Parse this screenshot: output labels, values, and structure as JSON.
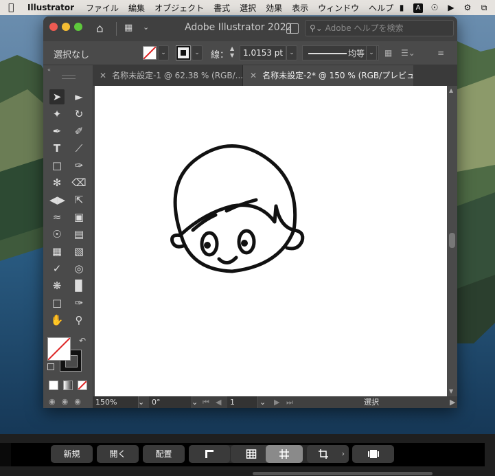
{
  "menubar": {
    "app": "Illustrator",
    "items": [
      "ファイル",
      "編集",
      "オブジェクト",
      "書式",
      "選択",
      "効果",
      "表示",
      "ウィンドウ",
      "ヘルプ"
    ],
    "status_icons": [
      "camera-icon",
      "input-source-icon",
      "accessibility-icon",
      "play-icon",
      "notification-icon",
      "window-icon"
    ],
    "input_source_label": "A"
  },
  "window": {
    "title": "Adobe Illustrator 2022",
    "search_placeholder": "Adobe ヘルプを検索"
  },
  "control_bar": {
    "selection": "選択なし",
    "stroke_label": "線：",
    "stroke_weight": "1.0153 pt",
    "stroke_profile": "均等"
  },
  "tabs": [
    {
      "label": "名称未設定-1 @ 62.38 % (RGB/...",
      "active": false
    },
    {
      "label": "名称未設定-2* @ 150 % (RGB/プレビュー)",
      "active": true
    }
  ],
  "status_bar": {
    "zoom": "150%",
    "rotation": "0°",
    "artboard": "1",
    "tool": "選択"
  },
  "touch_bar": {
    "new_label": "新規",
    "open_label": "開く",
    "place_label": "配置"
  },
  "colors": {
    "menubar_bg": "#e6e3df",
    "ui_bg": "#4a4a4a",
    "canvas_bg": "#ffffff",
    "artwork_stroke": "#111111",
    "none_slash": "#dd2222"
  }
}
